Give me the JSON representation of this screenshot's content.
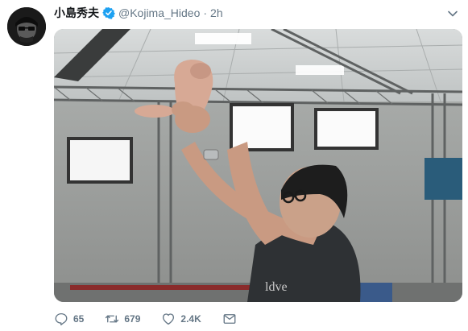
{
  "tweet": {
    "display_name": "小島秀夫",
    "handle": "@Kojima_Hideo",
    "separator": "·",
    "time": "2h",
    "verified": true,
    "shirt_text": "ldve"
  },
  "actions": {
    "reply": {
      "icon": "reply-icon",
      "count": "65"
    },
    "retweet": {
      "icon": "retweet-icon",
      "count": "679"
    },
    "like": {
      "icon": "heart-icon",
      "count": "2.4K"
    },
    "message": {
      "icon": "envelope-icon"
    }
  },
  "colors": {
    "verified": "#1da1f2",
    "icon_gray": "#657786",
    "text": "#14171a"
  }
}
